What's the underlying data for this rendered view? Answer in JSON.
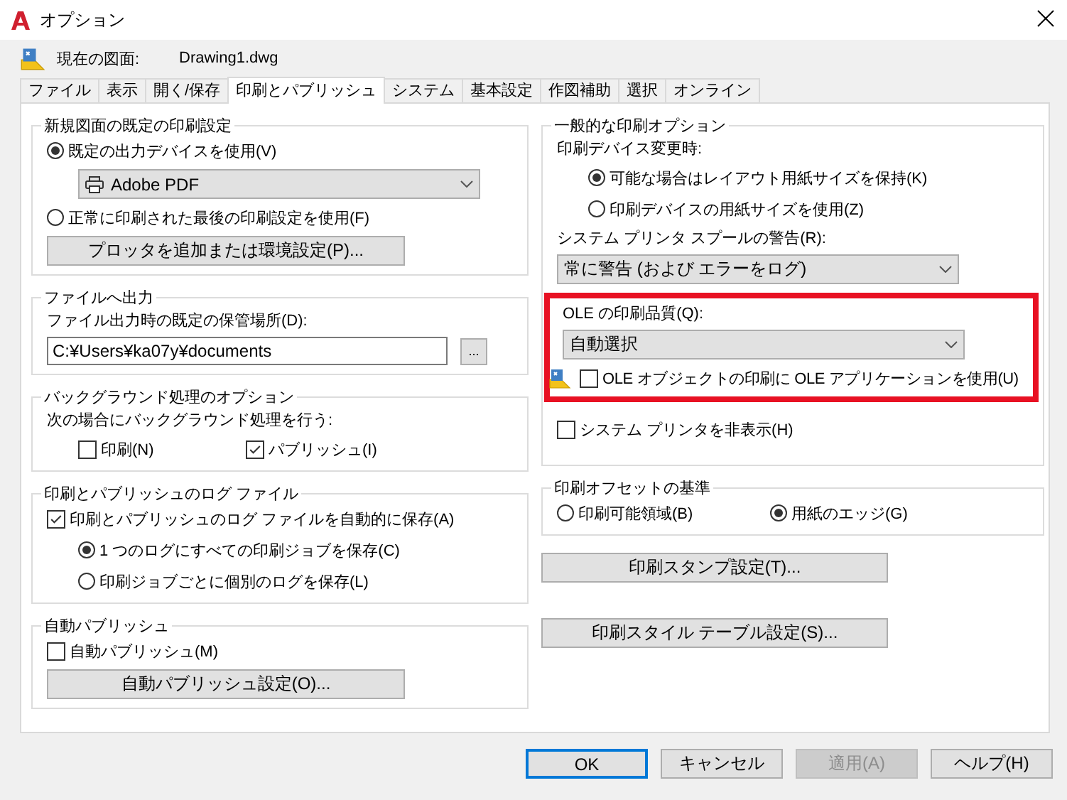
{
  "window": {
    "title": "オプション"
  },
  "current_drawing": {
    "label": "現在の図面:",
    "value": "Drawing1.dwg"
  },
  "tabs": [
    {
      "label": "ファイル",
      "selected": false
    },
    {
      "label": "表示",
      "selected": false
    },
    {
      "label": "開く/保存",
      "selected": false
    },
    {
      "label": "印刷とパブリッシュ",
      "selected": true
    },
    {
      "label": "システム",
      "selected": false
    },
    {
      "label": "基本設定",
      "selected": false
    },
    {
      "label": "作図補助",
      "selected": false
    },
    {
      "label": "選択",
      "selected": false
    },
    {
      "label": "オンライン",
      "selected": false
    }
  ],
  "left_column": [
    {
      "kind": "group",
      "title": "新規図面の既定の印刷設定",
      "items": [
        {
          "kind": "radio",
          "label": "既定の出力デバイスを使用(V)",
          "selected": true,
          "children": [
            {
              "kind": "device_dropdown",
              "value": "Adobe PDF"
            }
          ]
        },
        {
          "kind": "radio",
          "label": "正常に印刷された最後の印刷設定を使用(F)",
          "selected": false
        },
        {
          "kind": "button",
          "label": "プロッタを追加または環境設定(P)..."
        }
      ]
    },
    {
      "kind": "group",
      "title": "ファイルへ出力",
      "items": [
        {
          "kind": "label",
          "label": "ファイル出力時の既定の保管場所(D):"
        },
        {
          "kind": "path_field",
          "value": "C:¥Users¥ka07y¥documents",
          "button": "..."
        }
      ]
    },
    {
      "kind": "group",
      "title": "バックグラウンド処理のオプション",
      "items": [
        {
          "kind": "label",
          "label": "次の場合にバックグラウンド処理を行う:",
          "children": [
            {
              "kind": "row",
              "items": [
                {
                  "kind": "checkbox",
                  "label": "印刷(N)",
                  "checked": false
                },
                {
                  "kind": "checkbox",
                  "label": "パブリッシュ(I)",
                  "checked": true
                }
              ]
            }
          ]
        }
      ]
    },
    {
      "kind": "group",
      "title": "印刷とパブリッシュのログ ファイル",
      "items": [
        {
          "kind": "checkbox",
          "label": "印刷とパブリッシュのログ ファイルを自動的に保存(A)",
          "checked": true,
          "children": [
            {
              "kind": "radio",
              "label": "1 つのログにすべての印刷ジョブを保存(C)",
              "selected": true
            },
            {
              "kind": "radio",
              "label": "印刷ジョブごとに個別のログを保存(L)",
              "selected": false
            }
          ]
        }
      ]
    },
    {
      "kind": "group",
      "title": "自動パブリッシュ",
      "items": [
        {
          "kind": "checkbox",
          "label": "自動パブリッシュ(M)",
          "checked": false
        },
        {
          "kind": "button",
          "label": "自動パブリッシュ設定(O)..."
        }
      ]
    }
  ],
  "right_column": [
    {
      "kind": "group",
      "title": "一般的な印刷オプション",
      "items": [
        {
          "kind": "label",
          "label": "印刷デバイス変更時:",
          "children": [
            {
              "kind": "radio",
              "label": "可能な場合はレイアウト用紙サイズを保持(K)",
              "selected": true
            },
            {
              "kind": "radio",
              "label": "印刷デバイスの用紙サイズを使用(Z)",
              "selected": false
            }
          ]
        },
        {
          "kind": "label",
          "label": "システム プリンタ スプールの警告(R):"
        },
        {
          "kind": "dropdown",
          "value": "常に警告 (および エラーをログ)"
        },
        {
          "kind": "highlight",
          "items": [
            {
              "kind": "label",
              "label": "OLE の印刷品質(Q):"
            },
            {
              "kind": "dropdown",
              "value": "自動選択"
            },
            {
              "kind": "checkbox",
              "label": "OLE オブジェクトの印刷に OLE アプリケーションを使用(U)",
              "checked": false,
              "per_drawing": true
            }
          ]
        },
        {
          "kind": "checkbox",
          "label": "システム プリンタを非表示(H)",
          "checked": false,
          "per_drawing": false
        }
      ]
    },
    {
      "kind": "group",
      "title": "印刷オフセットの基準",
      "items": [
        {
          "kind": "row",
          "items": [
            {
              "kind": "radio",
              "label": "印刷可能領域(B)",
              "selected": false
            },
            {
              "kind": "radio",
              "label": "用紙のエッジ(G)",
              "selected": true
            }
          ]
        }
      ]
    },
    {
      "kind": "button",
      "label": "印刷スタンプ設定(T)..."
    },
    {
      "kind": "button",
      "label": "印刷スタイル テーブル設定(S)..."
    }
  ],
  "buttons": [
    {
      "label": "OK",
      "default": true,
      "disabled": false
    },
    {
      "label": "キャンセル",
      "default": false,
      "disabled": false
    },
    {
      "label": "適用(A)",
      "default": false,
      "disabled": true
    },
    {
      "label": "ヘルプ(H)",
      "default": false,
      "disabled": false
    }
  ]
}
